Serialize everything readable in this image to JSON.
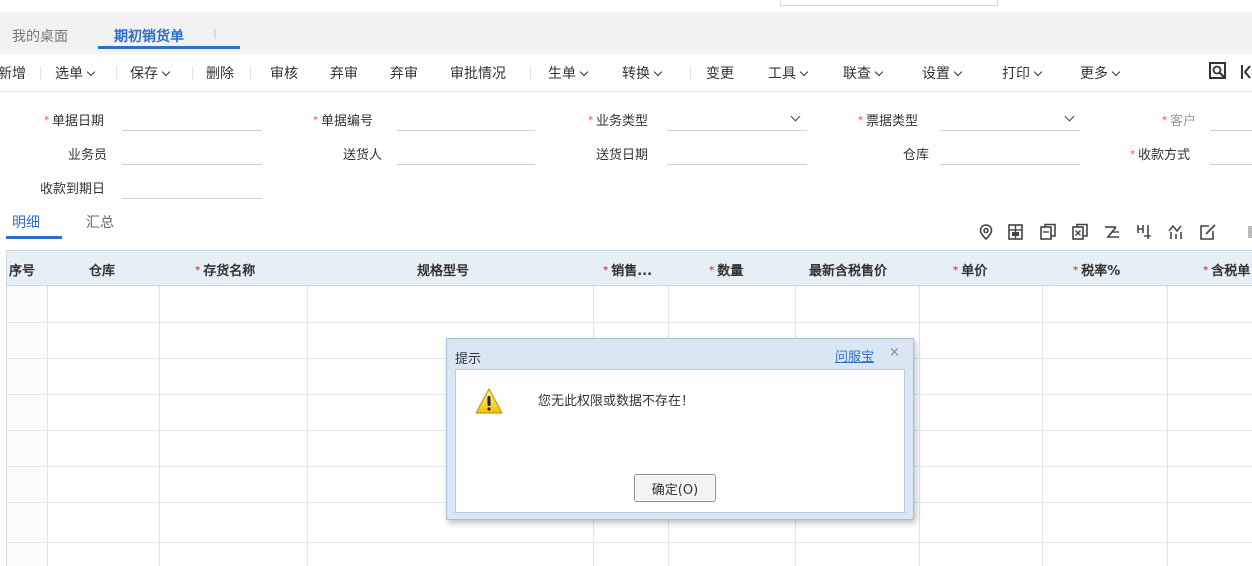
{
  "tabs": {
    "home": "我的桌面",
    "active": "期初销货单"
  },
  "toolbar": {
    "items": [
      {
        "label": "新增",
        "dropdown": false
      },
      {
        "label": "选单",
        "dropdown": true
      },
      {
        "label": "保存",
        "dropdown": true
      },
      {
        "label": "删除",
        "dropdown": false
      },
      {
        "label": "审核",
        "dropdown": false
      },
      {
        "label": "弃审",
        "dropdown": false
      },
      {
        "label": "弃审",
        "dropdown": false
      },
      {
        "label": "审批情况",
        "dropdown": false
      },
      {
        "label": "生单",
        "dropdown": true
      },
      {
        "label": "转换",
        "dropdown": true
      },
      {
        "label": "变更",
        "dropdown": false
      },
      {
        "label": "工具",
        "dropdown": true
      },
      {
        "label": "联查",
        "dropdown": true
      },
      {
        "label": "设置",
        "dropdown": true
      },
      {
        "label": "打印",
        "dropdown": true
      },
      {
        "label": "更多",
        "dropdown": true
      }
    ],
    "right_icons": [
      "search-doc-icon",
      "first-page-icon"
    ]
  },
  "form": {
    "row1": [
      {
        "label": "单据日期",
        "required": true,
        "value": ""
      },
      {
        "label": "单据编号",
        "required": true,
        "value": ""
      },
      {
        "label": "业务类型",
        "required": true,
        "value": "",
        "select": true
      },
      {
        "label": "票据类型",
        "required": true,
        "value": "",
        "select": true
      },
      {
        "label": "客户",
        "required": true,
        "value": ""
      }
    ],
    "row2": [
      {
        "label": "业务员",
        "required": false,
        "value": ""
      },
      {
        "label": "送货人",
        "required": false,
        "value": ""
      },
      {
        "label": "送货日期",
        "required": false,
        "value": ""
      },
      {
        "label": "仓库",
        "required": false,
        "value": ""
      },
      {
        "label": "收款方式",
        "required": true,
        "value": ""
      }
    ],
    "row3": [
      {
        "label": "收款到期日",
        "required": false,
        "value": ""
      }
    ]
  },
  "detail_tabs": {
    "active": "明细",
    "inactive": "汇总"
  },
  "grid": {
    "columns": [
      {
        "label": "序号",
        "required": false
      },
      {
        "label": "仓库",
        "required": false
      },
      {
        "label": "存货名称",
        "required": true
      },
      {
        "label": "规格型号",
        "required": false
      },
      {
        "label": "销售...",
        "required": true
      },
      {
        "label": "数量",
        "required": true
      },
      {
        "label": "最新含税售价",
        "required": false
      },
      {
        "label": "单价",
        "required": true
      },
      {
        "label": "税率%",
        "required": true
      },
      {
        "label": "含税单",
        "required": true
      }
    ],
    "icons": [
      "location-icon",
      "insert-row-icon",
      "copy-row-icon",
      "delete-row-icon",
      "batch-icon",
      "split-icon",
      "chart-icon",
      "edit-icon"
    ]
  },
  "dialog": {
    "title": "提示",
    "help_link": "问服宝",
    "close": "×",
    "message": "您无此权限或数据不存在！",
    "ok_button": "确定(O)"
  }
}
